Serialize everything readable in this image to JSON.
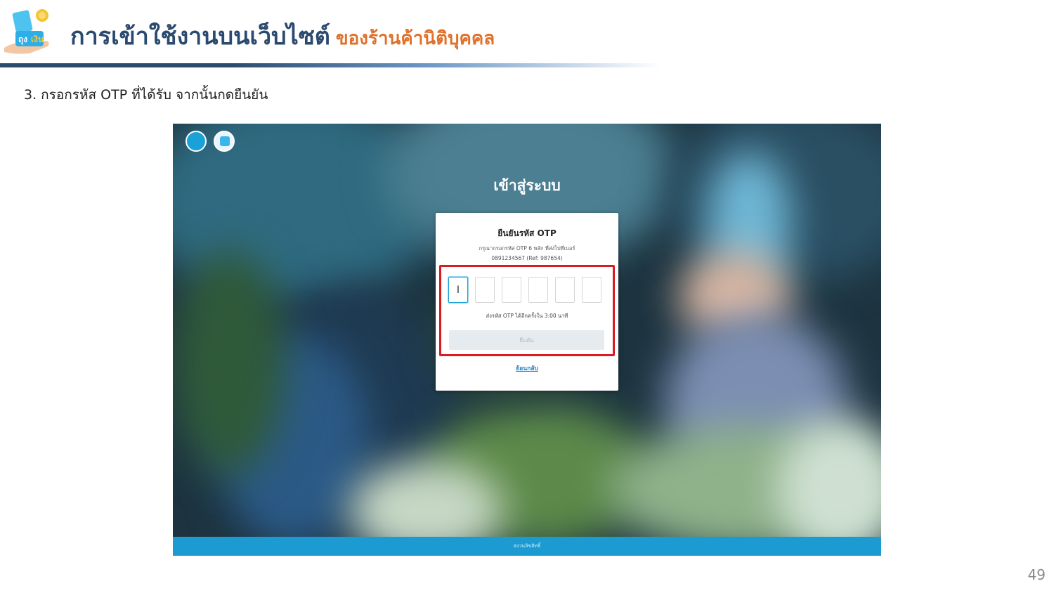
{
  "header": {
    "title_main": "การเข้าใช้งานบนเว็บไซต์",
    "title_sub": "ของร้านค้านิติบุคคล",
    "logo_text": "ถุงเงิน"
  },
  "step_text": "3. กรอกรหัส OTP ที่ได้รับ จากนั้นกดยืนยัน",
  "screenshot": {
    "login_title": "เข้าสู่ระบบ",
    "card": {
      "title": "ยืนยันรหัส OTP",
      "desc_line1": "กรุณากรอกรหัส OTP 6 หลัก ที่ส่งไปที่เบอร์",
      "desc_line2": "0891234567 (Ref: 987654)",
      "otp_boxes": [
        "I",
        "",
        "",
        "",
        "",
        ""
      ],
      "resend_text": "ส่งรหัส OTP ได้อีกครั้งใน 3:00 นาที",
      "confirm_label": "ยืนยัน",
      "back_label": "ย้อนกลับ"
    },
    "footer_text": "สงวนลิขสิทธิ์"
  },
  "page_number": "49",
  "colors": {
    "title_blue": "#2b4a6f",
    "title_orange": "#e0702a",
    "highlight_red": "#d81c22",
    "footer_blue": "#1b9bd1",
    "link_blue": "#1a7fbf"
  }
}
